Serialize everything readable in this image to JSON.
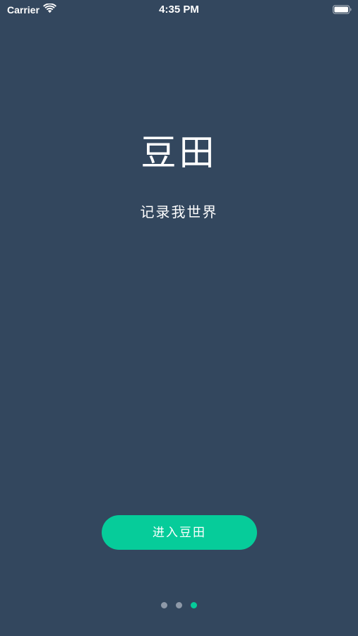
{
  "status_bar": {
    "carrier": "Carrier",
    "time": "4:35 PM",
    "wifi_icon": "wifi-icon",
    "battery_icon": "battery-full-icon"
  },
  "hero": {
    "title": "豆田",
    "subtitle": "记录我世界"
  },
  "enter_button": {
    "label": "进入豆田"
  },
  "page_indicator": {
    "count": 3,
    "current_index": 2
  },
  "colors": {
    "background": "#33475e",
    "accent": "#06cc9a",
    "text": "#ffffff",
    "dot_inactive": "#8e99a8"
  }
}
